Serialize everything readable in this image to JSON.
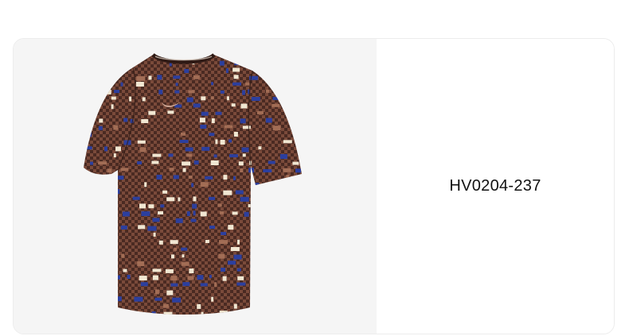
{
  "product": {
    "style_code": "HV0204-237",
    "image_icon": "patterned-tshirt-icon",
    "colors": {
      "shirt_base": "#4a2a22",
      "pattern_blue": "#2c3f9e",
      "pattern_cream": "#f1e7d2",
      "pattern_tan": "#a26d55",
      "logo": "#cfa896",
      "background": "#f5f5f5"
    }
  }
}
